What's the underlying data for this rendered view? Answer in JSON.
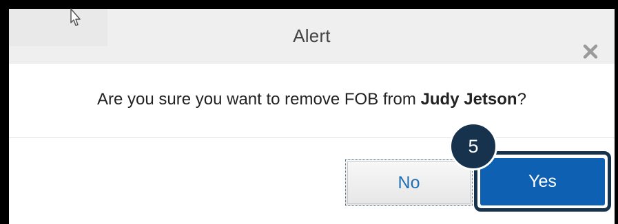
{
  "dialog": {
    "title": "Alert",
    "close_icon": "close-icon",
    "message_prefix": "Are you sure you want to remove FOB from ",
    "message_name": "Judy Jetson",
    "message_suffix": "?"
  },
  "buttons": {
    "no_label": "No",
    "yes_label": "Yes"
  },
  "annotation": {
    "step_number": "5",
    "highlight_color": "#17324d"
  },
  "colors": {
    "primary_button": "#0e60b2",
    "header_background": "#efefef"
  },
  "icons": {
    "cursor": "mouse-pointer-icon"
  }
}
